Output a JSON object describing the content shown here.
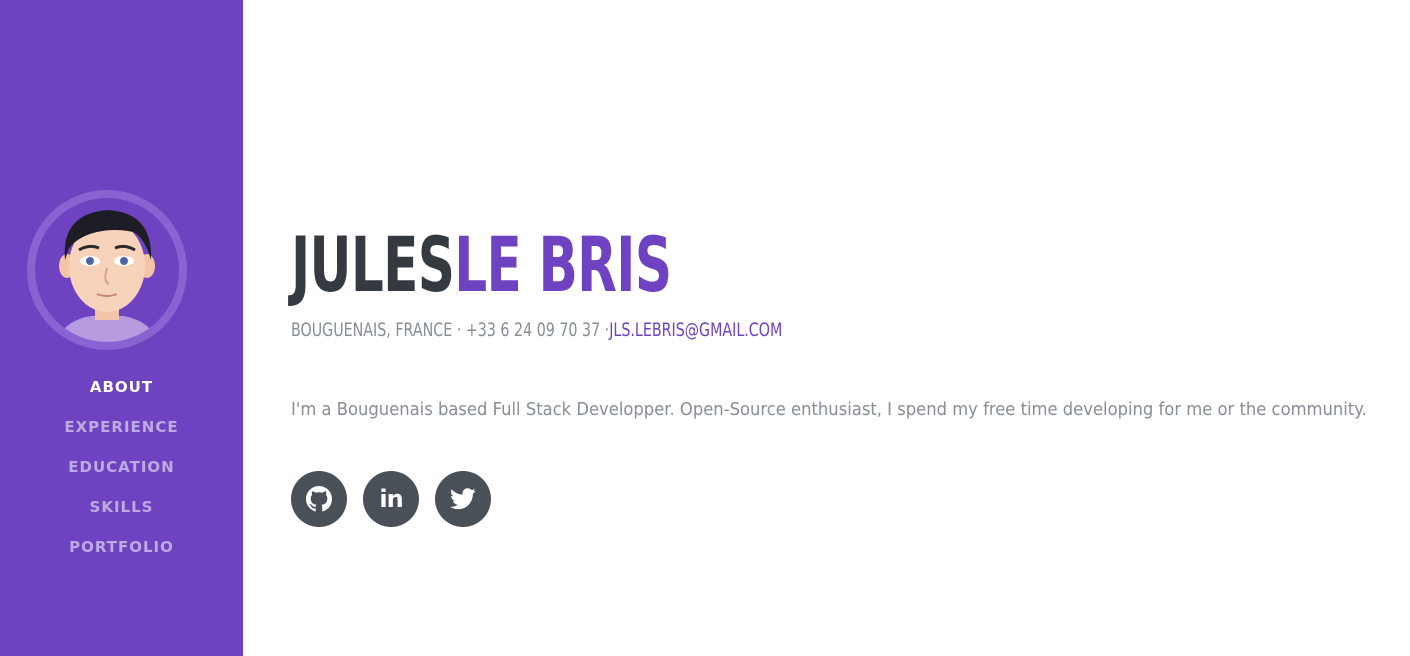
{
  "colors": {
    "primary": "#6f42c1",
    "dark": "#343a40",
    "muted": "#868e96",
    "social_bg": "#495057"
  },
  "sidebar": {
    "avatar_alt": "avatar",
    "nav": [
      {
        "label": "ABOUT",
        "active": true
      },
      {
        "label": "EXPERIENCE",
        "active": false
      },
      {
        "label": "EDUCATION",
        "active": false
      },
      {
        "label": "SKILLS",
        "active": false
      },
      {
        "label": "PORTFOLIO",
        "active": false
      }
    ]
  },
  "about": {
    "first_name": "JULES",
    "last_name": "LE BRIS",
    "location": "BOUGUENAIS, FRANCE · +33 6 24 09 70 37 ·",
    "email": "JLS.LEBRIS@GMAIL.COM",
    "lead": "I'm a Bouguenais based Full Stack Developper. Open-Source enthusiast, I spend my free time developing for me or the community.",
    "social": [
      {
        "name": "github-icon",
        "label": ""
      },
      {
        "name": "linkedin-icon",
        "label": "in"
      },
      {
        "name": "twitter-icon",
        "label": ""
      }
    ]
  }
}
